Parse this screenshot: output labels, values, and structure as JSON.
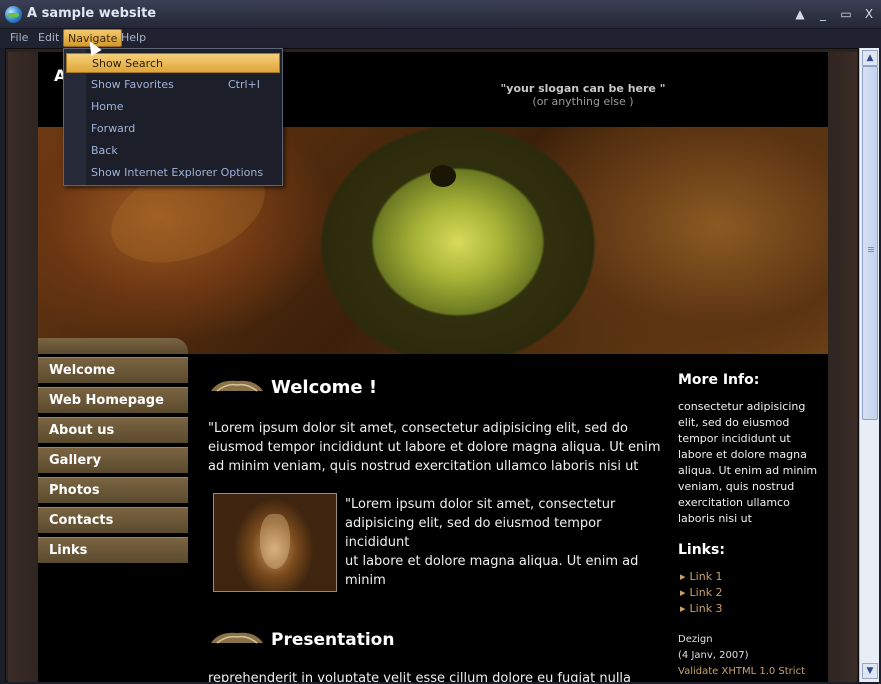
{
  "window": {
    "title": "A sample website"
  },
  "window_controls": {
    "up": "▲",
    "minimize": "_",
    "maximize": "▭",
    "close": "X"
  },
  "menubar": {
    "file": "File",
    "edit": "Edit",
    "navigate": "Navigate",
    "help": "Help"
  },
  "navigate_menu": {
    "items": [
      {
        "label": "Show Search",
        "shortcut": ""
      },
      {
        "label": "Show Favorites",
        "shortcut": "Ctrl+I"
      },
      {
        "label": "Home",
        "shortcut": ""
      },
      {
        "label": "Forward",
        "shortcut": ""
      },
      {
        "label": "Back",
        "shortcut": ""
      },
      {
        "label": "Show Internet Explorer Options",
        "shortcut": ""
      }
    ],
    "highlighted_index": 0
  },
  "site": {
    "logo_letter": "A",
    "slogan": "\"your slogan can be here \"",
    "slogan_sub": "(or anything else )"
  },
  "nav": [
    "Welcome",
    "Web Homepage",
    "About us",
    "Gallery",
    "Photos",
    "Contacts",
    "Links"
  ],
  "main": {
    "welcome_title": "Welcome !",
    "welcome_p1_lines": [
      "\"Lorem ipsum dolor sit amet, consectetur adipisicing elit, sed do",
      "eiusmod tempor incididunt ut labore et dolore magna aliqua. Ut enim",
      "ad minim veniam, quis nostrud exercitation ullamco laboris nisi ut"
    ],
    "welcome_p2_lines": [
      "\"Lorem ipsum dolor sit amet, consectetur",
      "adipisicing elit, sed do eiusmod tempor incididunt",
      "ut labore et dolore magna aliqua. Ut enim ad",
      "minim"
    ],
    "presentation_title": "Presentation",
    "presentation_line": "reprehenderit in voluptate velit esse cillum dolore eu fugiat nulla"
  },
  "sidebar": {
    "more_info_title": "More Info:",
    "more_info_lines": [
      "consectetur adipisicing",
      "elit, sed do eiusmod",
      "tempor incididunt ut",
      "labore et dolore magna",
      "aliqua. Ut enim ad minim",
      "veniam, quis nostrud",
      "exercitation ullamco",
      "laboris nisi ut"
    ],
    "links_title": "Links:",
    "links": [
      "Link 1",
      "Link 2",
      "Link 3"
    ],
    "credit_line1": "Dezign",
    "credit_line2": "(4 Janv, 2007)",
    "validate": "Validate XHTML 1.0 Strict"
  },
  "scrollbar": {
    "up_arrow": "▲",
    "down_arrow": "▼"
  },
  "colors": {
    "accent_gold": "#e0a63a",
    "nav_brown": "#6b5637",
    "link_gold": "#c8a26a"
  }
}
